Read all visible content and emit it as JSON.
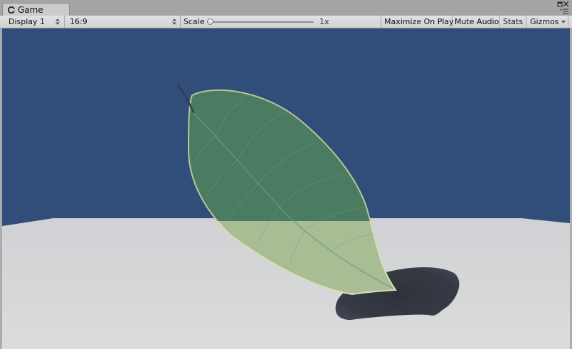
{
  "window": {
    "tab_label": "Game",
    "tab_icon": "game-controller-icon",
    "window_controls": [
      "maximize-icon",
      "close-icon",
      "tab-menu-icon"
    ]
  },
  "toolbar": {
    "display": {
      "selected": "Display 1"
    },
    "aspect": {
      "selected": "16:9"
    },
    "scale": {
      "label": "Scale",
      "value": "1x",
      "level": 0.0
    },
    "maximize_on_play": "Maximize On Play",
    "mute_audio": "Mute Audio",
    "stats": "Stats",
    "gizmos": "Gizmos"
  },
  "viewport": {
    "description_free": true,
    "colors": {
      "sky": "#314d7a",
      "ground": "#d2d4d7",
      "leaf": "#4a7a60",
      "leaf_over_ground": "#a8bb94",
      "shadow": "#30353d",
      "stem": "#3e3652"
    }
  }
}
